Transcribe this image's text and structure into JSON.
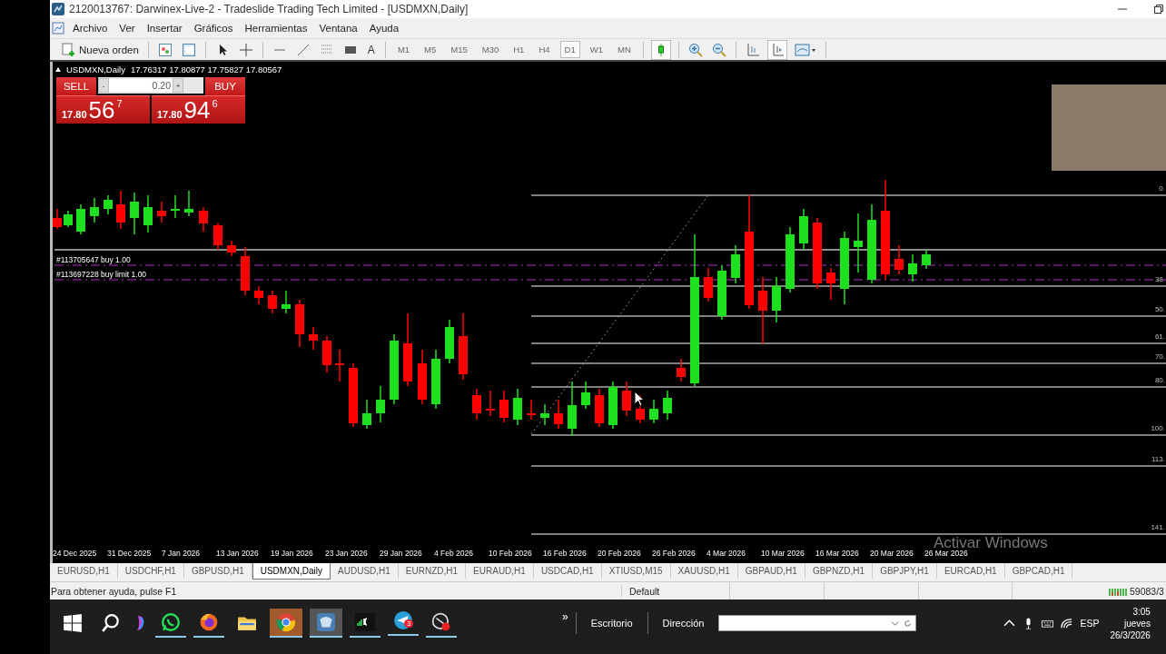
{
  "window": {
    "title": "2120013767: Darwinex-Live-2 - Tradeslide Trading Tech Limited - [USDMXN,Daily]"
  },
  "menu": [
    "Archivo",
    "Ver",
    "Insertar",
    "Gráficos",
    "Herramientas",
    "Ventana",
    "Ayuda"
  ],
  "toolbar": {
    "new_order": "Nueva orden",
    "text_tool": "A",
    "timeframes": [
      {
        "label": "M1",
        "selected": false
      },
      {
        "label": "M5",
        "selected": false
      },
      {
        "label": "M15",
        "selected": false
      },
      {
        "label": "M30",
        "selected": false
      },
      {
        "label": "H1",
        "selected": false
      },
      {
        "label": "H4",
        "selected": false
      },
      {
        "label": "D1",
        "selected": true
      },
      {
        "label": "W1",
        "selected": false
      },
      {
        "label": "MN",
        "selected": false
      }
    ]
  },
  "chart": {
    "symbol": "USDMXN,Daily",
    "ohlc": "17.76317 17.80877 17.75827 17.80567",
    "trade_panel": {
      "sell": "SELL",
      "buy": "BUY",
      "volume": "0.20",
      "down": "-",
      "up": "+",
      "sell_price": {
        "prefix": "17.80",
        "big": "56",
        "sup": "7"
      },
      "buy_price": {
        "prefix": "17.80",
        "big": "94",
        "sup": "6"
      }
    },
    "orders": [
      "#113705647 buy 1.00",
      "#113697228 buy limit 1.00"
    ],
    "fib_levels": [
      "0.",
      "38.",
      "50.",
      "61.",
      "70.",
      "80.",
      "100.",
      "113.",
      "141."
    ],
    "dates": [
      "24 Dec 2025",
      "31 Dec 2025",
      "7 Jan 2026",
      "13 Jan 2026",
      "19 Jan 2026",
      "23 Jan 2026",
      "29 Jan 2026",
      "4 Feb 2026",
      "10 Feb 2026",
      "16 Feb 2026",
      "20 Feb 2026",
      "26 Feb 2026",
      "4 Mar 2026",
      "10 Mar 2026",
      "16 Mar 2026",
      "20 Mar 2026",
      "26 Mar 2026"
    ],
    "os_notice": "Activar Windows"
  },
  "tabs": [
    {
      "label": "EURUSD,H1",
      "selected": false
    },
    {
      "label": "USDCHF,H1",
      "selected": false
    },
    {
      "label": "GBPUSD,H1",
      "selected": false
    },
    {
      "label": "USDMXN,Daily",
      "selected": true
    },
    {
      "label": "AUDUSD,H1",
      "selected": false
    },
    {
      "label": "EURNZD,H1",
      "selected": false
    },
    {
      "label": "EURAUD,H1",
      "selected": false
    },
    {
      "label": "USDCAD,H1",
      "selected": false
    },
    {
      "label": "XTIUSD,M15",
      "selected": false
    },
    {
      "label": "XAUUSD,H1",
      "selected": false
    },
    {
      "label": "GBPAUD,H1",
      "selected": false
    },
    {
      "label": "GBPNZD,H1",
      "selected": false
    },
    {
      "label": "GBPJPY,H1",
      "selected": false
    },
    {
      "label": "EURCAD,H1",
      "selected": false
    },
    {
      "label": "GBPCAD,H1",
      "selected": false
    }
  ],
  "status_bar": {
    "help": "Para obtener ayuda, pulse F1",
    "profile": "Default",
    "traffic": "59083/3"
  },
  "taskbar": {
    "telegram_badge": "3",
    "more": "»",
    "desktop": "Escritorio",
    "address_label": "Dirección",
    "language": "ESP",
    "time": "3:05",
    "day": "jueves",
    "date": "26/3/2026"
  }
}
